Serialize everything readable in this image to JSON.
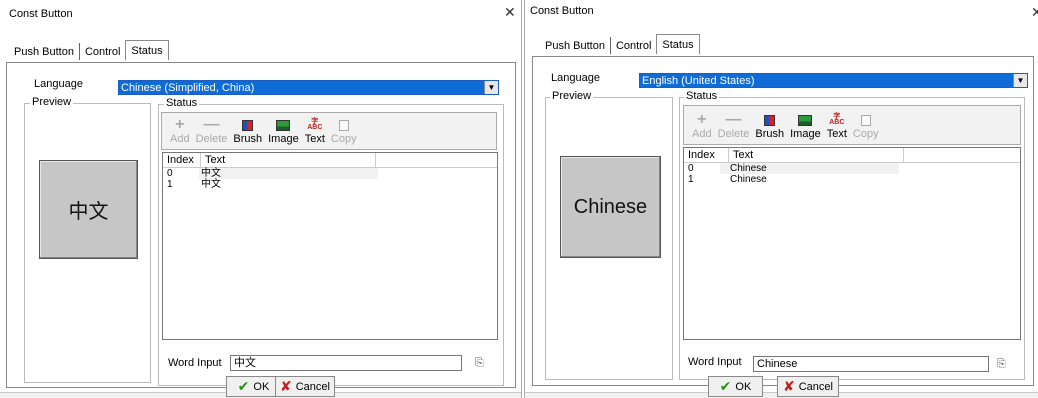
{
  "left": {
    "title": "Const Button",
    "close": "✕",
    "tabs": [
      "Push Button",
      "Control",
      "Status"
    ],
    "language_label": "Language",
    "language_value": "Chinese (Simplified, China)",
    "preview_label": "Preview",
    "preview_text": "中文",
    "status_label": "Status",
    "toolbar": [
      "Add",
      "Delete",
      "Brush",
      "Image",
      "Text",
      "Copy"
    ],
    "columns": [
      "Index",
      "Text"
    ],
    "rows": [
      {
        "index": "0",
        "text": "中文"
      },
      {
        "index": "1",
        "text": "中文"
      }
    ],
    "word_input_label": "Word Input",
    "word_input_value": "中文",
    "ok": "OK",
    "cancel": "Cancel"
  },
  "right": {
    "title": "Const Button",
    "close": "✕",
    "tabs": [
      "Push Button",
      "Control",
      "Status"
    ],
    "language_label": "Language",
    "language_value": "English (United States)",
    "preview_label": "Preview",
    "preview_text": "Chinese",
    "status_label": "Status",
    "toolbar": [
      "Add",
      "Delete",
      "Brush",
      "Image",
      "Text",
      "Copy"
    ],
    "columns": [
      "Index",
      "Text"
    ],
    "rows": [
      {
        "index": "0",
        "text": "Chinese"
      },
      {
        "index": "1",
        "text": "Chinese"
      }
    ],
    "word_input_label": "Word Input",
    "word_input_value": "Chinese",
    "ok": "OK",
    "cancel": "Cancel"
  },
  "icons": {
    "add": "add-icon",
    "delete": "delete-icon",
    "brush": "brush-icon",
    "image": "image-icon",
    "text": "text-icon",
    "copy": "copy-icon",
    "ok": "checkmark-icon",
    "cancel": "x-icon",
    "pick": "character-picker-icon"
  },
  "colors": {
    "select_bg": "#0f6bd6",
    "preview_bg": "#c6c6c6",
    "ok_icon": "#2f8f19",
    "cancel_icon": "#c02020"
  }
}
